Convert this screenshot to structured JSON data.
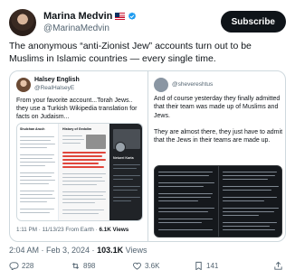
{
  "author": {
    "display_name": "Marina Medvin",
    "handle": "@MarinaMedvin",
    "flag_icon": "us-flag-icon",
    "verified_icon": "verified-badge-icon",
    "verified_color": "#1d9bf0"
  },
  "subscribe_label": "Subscribe",
  "tweet_text": "The anonymous “anti-Zionist Jew” accounts turn out to be Muslims in Islamic countries — every single time.",
  "left_quote": {
    "display_name": "Halsey English",
    "handle": "@RealHalseyE",
    "text": "From your favorite account...Torah Jews.. they use a Turkish Wikipedia translation for facts on Judaism...",
    "shot_titles": [
      "Shulchan Aruch",
      "History of Gedolim",
      "Neturei Karta"
    ],
    "time": "1:11 PM · 11/13/23 From Earth · ",
    "views": "6.1K Views"
  },
  "right_quote": {
    "handle": "@shevereshtus",
    "text_1": "And of course yesterday they finally admitted that their team was made up of Muslims and Jews.",
    "text_2": "They are almost there, they just have to admit that the Jews in their teams are made up."
  },
  "meta": {
    "time": "2:04 AM · Feb 3, 2024 · ",
    "views_count": "103.1K",
    "views_label": " Views"
  },
  "actions": {
    "replies": "228",
    "reposts": "898",
    "likes": "3.6K",
    "bookmarks": "141"
  },
  "colors": {
    "text": "#0f1419",
    "secondary": "#536471",
    "border": "#cfd9de"
  }
}
